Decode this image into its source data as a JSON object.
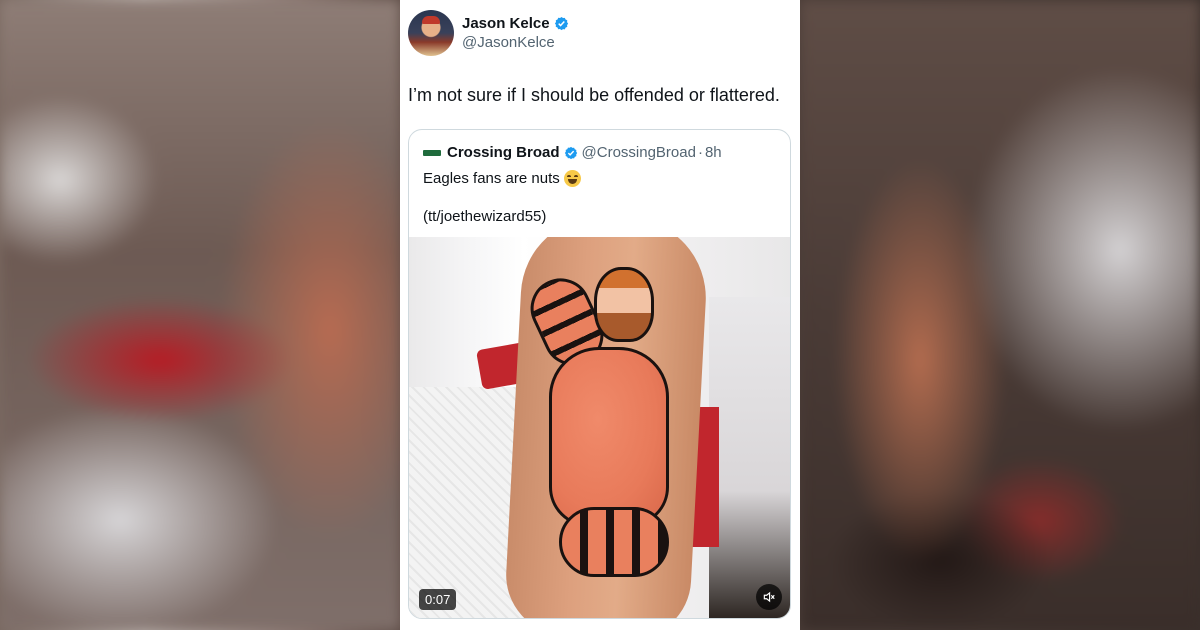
{
  "tweet": {
    "author_name": "Jason Kelce",
    "author_handle": "@JasonKelce",
    "text": "I’m not sure if I should be offended or flattered.",
    "verified_color": "#1d9bf0"
  },
  "quoted_tweet": {
    "author_name": "Crossing Broad",
    "author_handle": "@CrossingBroad",
    "separator": "·",
    "time": "8h",
    "text_line1": "Eagles fans are nuts",
    "emoji": "face-with-tears-of-joy",
    "text_line2": "(tt/joethewizard55)",
    "media": {
      "type": "video",
      "timestamp": "0:07",
      "muted_icon": "speaker-muted-icon"
    }
  }
}
